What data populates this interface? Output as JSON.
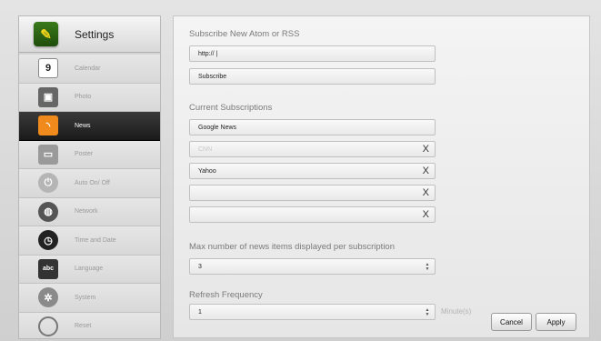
{
  "sidebar": {
    "title": "Settings",
    "items": [
      {
        "label": "Calendar",
        "icon": "calendar-icon",
        "glyph": "9",
        "active": false
      },
      {
        "label": "Photo",
        "icon": "photo-icon",
        "glyph": "▣",
        "active": false
      },
      {
        "label": "News",
        "icon": "rss-icon",
        "glyph": "◝",
        "active": true
      },
      {
        "label": "Poster",
        "icon": "poster-icon",
        "glyph": "▭",
        "active": false
      },
      {
        "label": "Auto On/ Off",
        "icon": "power-icon",
        "glyph": "⏻",
        "active": false
      },
      {
        "label": "Network",
        "icon": "globe-icon",
        "glyph": "◍",
        "active": false
      },
      {
        "label": "Time and Date",
        "icon": "clock-icon",
        "glyph": "◷",
        "active": false
      },
      {
        "label": "Language",
        "icon": "language-icon",
        "glyph": "abc",
        "active": false
      },
      {
        "label": "System",
        "icon": "system-icon",
        "glyph": "✲",
        "active": false
      },
      {
        "label": "Reset",
        "icon": "reset-icon",
        "glyph": "",
        "active": false
      }
    ]
  },
  "subscribe": {
    "label": "Subscribe New Atom or RSS",
    "url_value": "http:// |",
    "subscribe_button": "Subscribe"
  },
  "subscriptions": {
    "label": "Current Subscriptions",
    "header": "Google News",
    "rows": [
      {
        "value": "CNN",
        "dim": true
      },
      {
        "value": "Yahoo",
        "dim": false
      },
      {
        "value": "",
        "dim": false
      },
      {
        "value": "",
        "dim": false
      }
    ],
    "remove_glyph": "X"
  },
  "max_items": {
    "label": "Max number of news items displayed per subscription",
    "value": "3"
  },
  "refresh": {
    "label": "Refresh Frequency",
    "value": "1",
    "unit": "Minute(s)"
  },
  "actions": {
    "cancel": "Cancel",
    "apply": "Apply"
  }
}
